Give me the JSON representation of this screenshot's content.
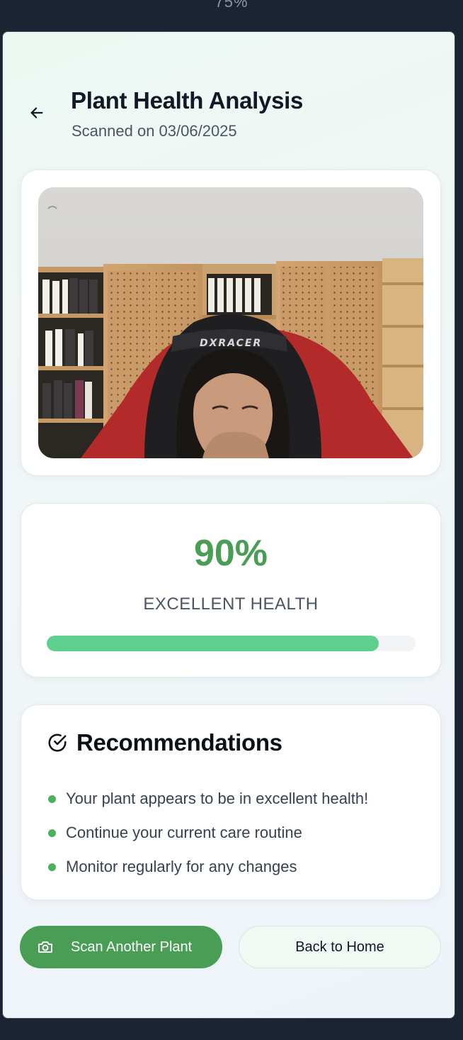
{
  "browser": {
    "zoom": "75%"
  },
  "header": {
    "back_icon": "arrow-left-icon",
    "title": "Plant Health Analysis",
    "subtitle": "Scanned on 03/06/2025"
  },
  "photo": {
    "chair_text": "DXRACER"
  },
  "health": {
    "score_text": "90%",
    "score_fraction": 0.9,
    "label": "EXCELLENT HEALTH",
    "accent_color": "#4a9d55",
    "bar_color": "#5fcf8f"
  },
  "recommendations": {
    "icon": "check-circle-icon",
    "title": "Recommendations",
    "items": [
      "Your plant appears to be in excellent health!",
      "Continue your current care routine",
      "Monitor regularly for any changes"
    ]
  },
  "actions": {
    "primary_icon": "camera-icon",
    "primary_label": "Scan Another Plant",
    "secondary_label": "Back to Home"
  }
}
